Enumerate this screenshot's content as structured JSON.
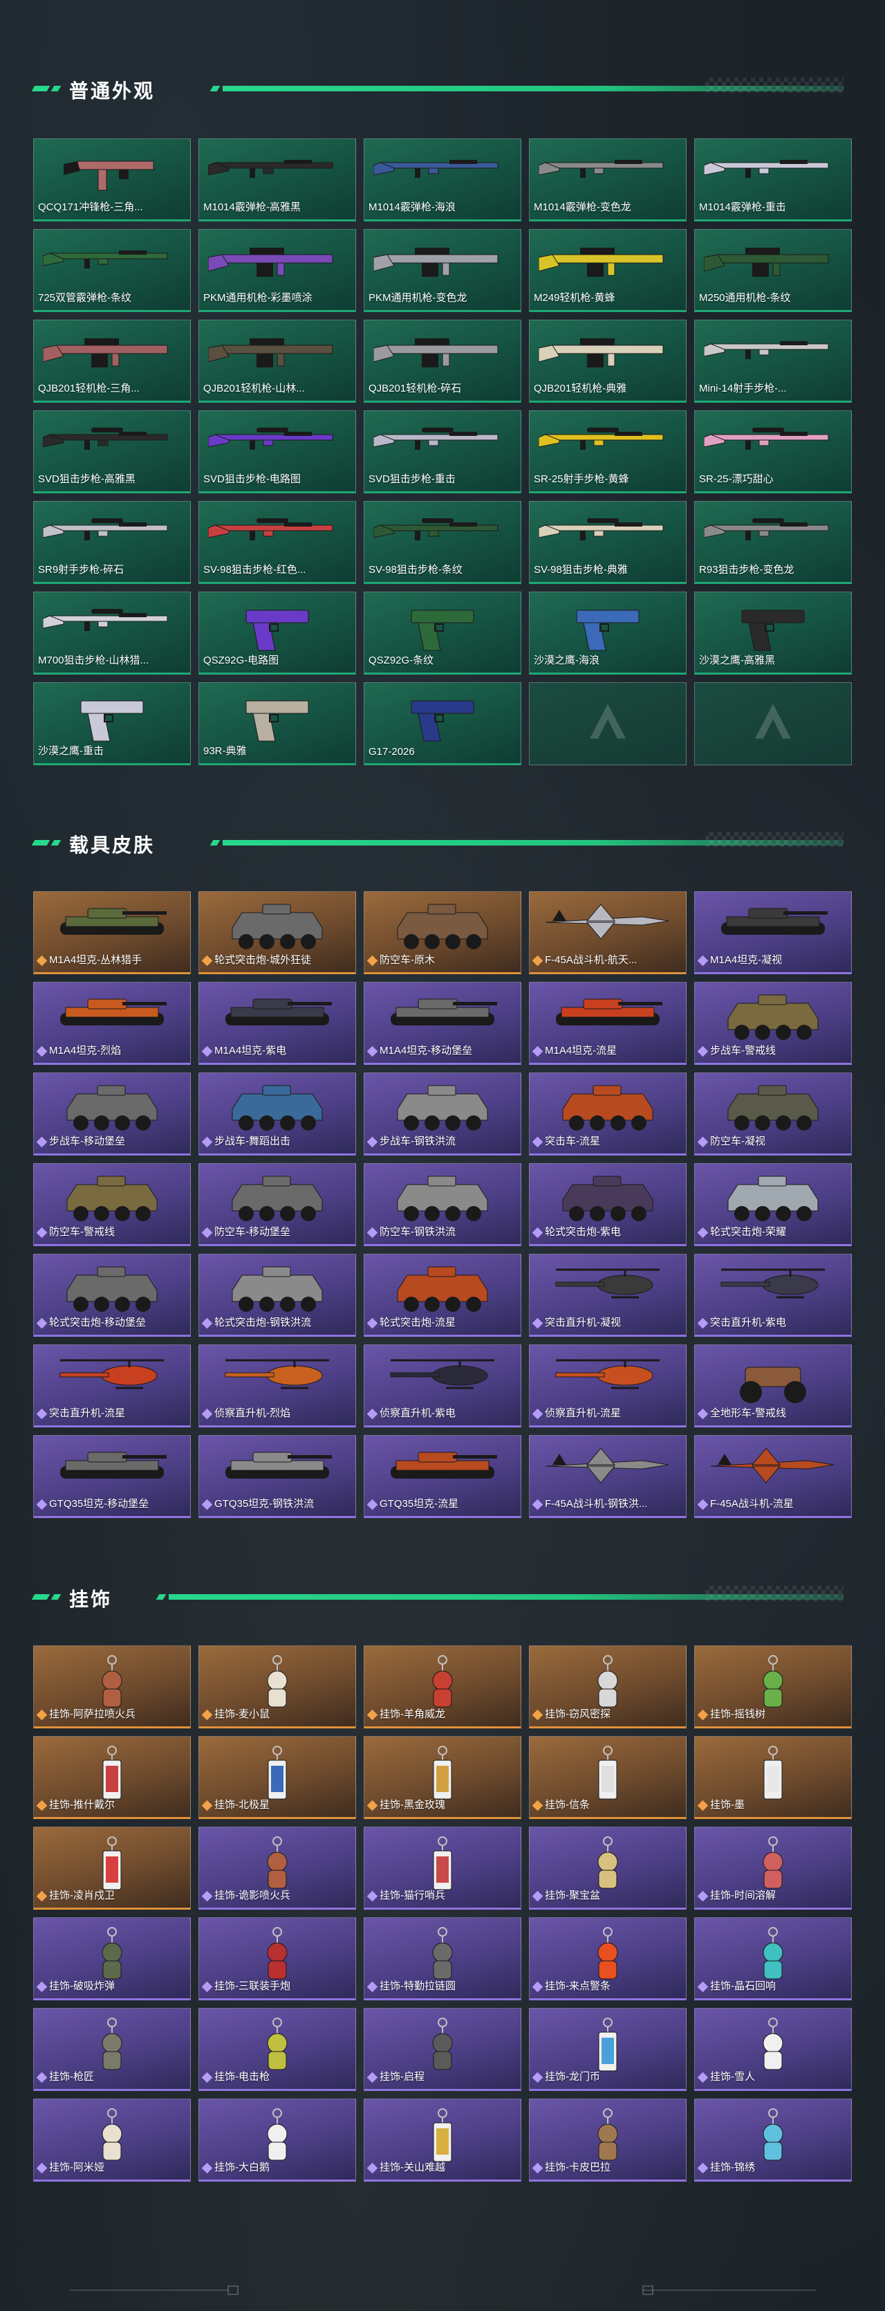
{
  "sections": [
    {
      "title": "普通外观",
      "rarity": "green",
      "items": [
        {
          "label": "QCQ171冲锋枪-三角...",
          "kind": "smg",
          "color": "#b06a6a"
        },
        {
          "label": "M1014霰弹枪-高雅黑",
          "kind": "shotgun",
          "color": "#2a2a2a"
        },
        {
          "label": "M1014霰弹枪-海浪",
          "kind": "shotgun",
          "color": "#3a5a9a"
        },
        {
          "label": "M1014霰弹枪-变色龙",
          "kind": "shotgun",
          "color": "#8a8a8a"
        },
        {
          "label": "M1014霰弹枪-重击",
          "kind": "shotgun",
          "color": "#c8c8d8"
        },
        {
          "label": "725双管霰弹枪-条纹",
          "kind": "rifle",
          "color": "#2f6a3a"
        },
        {
          "label": "PKM通用机枪-彩墨喷涂",
          "kind": "mg",
          "color": "#7a4ab8"
        },
        {
          "label": "PKM通用机枪-变色龙",
          "kind": "mg",
          "color": "#a0a0a8"
        },
        {
          "label": "M249轻机枪-黄蜂",
          "kind": "mg",
          "color": "#d8c428"
        },
        {
          "label": "M250通用机枪-条纹",
          "kind": "mg",
          "color": "#2d5a34"
        },
        {
          "label": "QJB201轻机枪-三角...",
          "kind": "mg",
          "color": "#a26060"
        },
        {
          "label": "QJB201轻机枪-山林...",
          "kind": "mg",
          "color": "#5a5040"
        },
        {
          "label": "QJB201轻机枪-碎石",
          "kind": "mg",
          "color": "#9a9aa0"
        },
        {
          "label": "QJB201轻机枪-典雅",
          "kind": "mg",
          "color": "#d8d0b8"
        },
        {
          "label": "Mini-14射手步枪-...",
          "kind": "rifle",
          "color": "#c8c8c8"
        },
        {
          "label": "SVD狙击步枪-高雅黑",
          "kind": "sniper",
          "color": "#2a2a2a"
        },
        {
          "label": "SVD狙击步枪-电路图",
          "kind": "sniper",
          "color": "#6a3ac8"
        },
        {
          "label": "SVD狙击步枪-重击",
          "kind": "sniper",
          "color": "#b8b8c8"
        },
        {
          "label": "SR-25射手步枪-黄蜂",
          "kind": "sniper",
          "color": "#e0c020"
        },
        {
          "label": "SR-25-漂巧甜心",
          "kind": "sniper",
          "color": "#e0a0c0"
        },
        {
          "label": "SR9射手步枪-碎石",
          "kind": "sniper",
          "color": "#c0c0c8"
        },
        {
          "label": "SV-98狙击步枪-红色...",
          "kind": "sniper",
          "color": "#c84040"
        },
        {
          "label": "SV-98狙击步枪-条纹",
          "kind": "sniper",
          "color": "#2d5a34"
        },
        {
          "label": "SV-98狙击步枪-典雅",
          "kind": "sniper",
          "color": "#d8d0b8"
        },
        {
          "label": "R93狙击步枪-变色龙",
          "kind": "sniper",
          "color": "#8a8a8a"
        },
        {
          "label": "M700狙击步枪-山林猎...",
          "kind": "sniper",
          "color": "#d0d0d8"
        },
        {
          "label": "QSZ92G-电路图",
          "kind": "pistol",
          "color": "#6a3ac8"
        },
        {
          "label": "QSZ92G-条纹",
          "kind": "pistol",
          "color": "#2d6a3a"
        },
        {
          "label": "沙漠之鹰-海浪",
          "kind": "pistol",
          "color": "#3a6ab8"
        },
        {
          "label": "沙漠之鹰-高雅黑",
          "kind": "pistol",
          "color": "#2a2a2a"
        },
        {
          "label": "沙漠之鹰-重击",
          "kind": "pistol",
          "color": "#c8c8d8"
        },
        {
          "label": "93R-典雅",
          "kind": "pistol",
          "color": "#b8b0a0"
        },
        {
          "label": "G17-2026",
          "kind": "pistol",
          "color": "#2a3a8a"
        },
        {
          "label": "",
          "kind": "empty",
          "color": ""
        },
        {
          "label": "",
          "kind": "empty",
          "color": ""
        }
      ]
    },
    {
      "title": "载具皮肤",
      "items": [
        {
          "label": "M1A4坦克-丛林猎手",
          "kind": "tank",
          "rarity": "orange",
          "color": "#5a6a3a"
        },
        {
          "label": "轮式突击炮-城外狂徒",
          "kind": "apc",
          "rarity": "orange",
          "color": "#6a6a6a"
        },
        {
          "label": "防空车-原木",
          "kind": "apc",
          "rarity": "orange",
          "color": "#7a5a40"
        },
        {
          "label": "F-45A战斗机-航天...",
          "kind": "jet",
          "rarity": "orange",
          "color": "#b8b8c0"
        },
        {
          "label": "M1A4坦克-凝视",
          "kind": "tank",
          "rarity": "purple",
          "color": "#3a3a3a"
        },
        {
          "label": "M1A4坦克-烈焰",
          "kind": "tank",
          "rarity": "purple",
          "color": "#c85a20"
        },
        {
          "label": "M1A4坦克-紫电",
          "kind": "tank",
          "rarity": "purple",
          "color": "#3a3a4a"
        },
        {
          "label": "M1A4坦克-移动堡垒",
          "kind": "tank",
          "rarity": "purple",
          "color": "#6a6a6a"
        },
        {
          "label": "M1A4坦克-流星",
          "kind": "tank",
          "rarity": "purple",
          "color": "#c84020"
        },
        {
          "label": "步战车-警戒线",
          "kind": "apc",
          "rarity": "purple",
          "color": "#7a6a40"
        },
        {
          "label": "步战车-移动堡垒",
          "kind": "apc",
          "rarity": "purple",
          "color": "#6a6a6a"
        },
        {
          "label": "步战车-舞蹈出击",
          "kind": "apc",
          "rarity": "purple",
          "color": "#3a6a9a"
        },
        {
          "label": "步战车-钢铁洪流",
          "kind": "apc",
          "rarity": "purple",
          "color": "#8a8a8a"
        },
        {
          "label": "突击车-流星",
          "kind": "apc",
          "rarity": "purple",
          "color": "#b84a20"
        },
        {
          "label": "防空车-凝视",
          "kind": "apc",
          "rarity": "purple",
          "color": "#5a5a4a"
        },
        {
          "label": "防空车-警戒线",
          "kind": "apc",
          "rarity": "purple",
          "color": "#7a6a40"
        },
        {
          "label": "防空车-移动堡垒",
          "kind": "apc",
          "rarity": "purple",
          "color": "#6a6a6a"
        },
        {
          "label": "防空车-钢铁洪流",
          "kind": "apc",
          "rarity": "purple",
          "color": "#8a8a8a"
        },
        {
          "label": "轮式突击炮-紫电",
          "kind": "apc",
          "rarity": "purple",
          "color": "#4a3a5a"
        },
        {
          "label": "轮式突击炮-荣耀",
          "kind": "apc",
          "rarity": "purple",
          "color": "#a0a8b0"
        },
        {
          "label": "轮式突击炮-移动堡垒",
          "kind": "apc",
          "rarity": "purple",
          "color": "#6a6a6a"
        },
        {
          "label": "轮式突击炮-钢铁洪流",
          "kind": "apc",
          "rarity": "purple",
          "color": "#8a8a8a"
        },
        {
          "label": "轮式突击炮-流星",
          "kind": "apc",
          "rarity": "purple",
          "color": "#b84a20"
        },
        {
          "label": "突击直升机-凝视",
          "kind": "heli",
          "rarity": "purple",
          "color": "#3a3a3a"
        },
        {
          "label": "突击直升机-紫电",
          "kind": "heli",
          "rarity": "purple",
          "color": "#3a3a4a"
        },
        {
          "label": "突击直升机-流星",
          "kind": "heli",
          "rarity": "purple",
          "color": "#c84020"
        },
        {
          "label": "侦察直升机-烈焰",
          "kind": "heli",
          "rarity": "purple",
          "color": "#c86020"
        },
        {
          "label": "侦察直升机-紫电",
          "kind": "heli",
          "rarity": "purple",
          "color": "#2a2a3a"
        },
        {
          "label": "侦察直升机-流星",
          "kind": "heli",
          "rarity": "purple",
          "color": "#c85020"
        },
        {
          "label": "全地形车-警戒线",
          "kind": "atv",
          "rarity": "purple",
          "color": "#8a5a3a"
        },
        {
          "label": "GTQ35坦克-移动堡垒",
          "kind": "tank",
          "rarity": "purple",
          "color": "#6a6a6a"
        },
        {
          "label": "GTQ35坦克-钢铁洪流",
          "kind": "tank",
          "rarity": "purple",
          "color": "#8a8a8a"
        },
        {
          "label": "GTQ35坦克-流星",
          "kind": "tank",
          "rarity": "purple",
          "color": "#b84a20"
        },
        {
          "label": "F-45A战斗机-钢铁洪...",
          "kind": "jet",
          "rarity": "purple",
          "color": "#8a8a8a"
        },
        {
          "label": "F-45A战斗机-流星",
          "kind": "jet",
          "rarity": "purple",
          "color": "#b84a20"
        }
      ]
    },
    {
      "title": "挂饰",
      "items": [
        {
          "label": "挂饰-阿萨拉喷火兵",
          "kind": "charm",
          "rarity": "orange",
          "color": "#b06040"
        },
        {
          "label": "挂饰-麦小鼠",
          "kind": "charm",
          "rarity": "orange",
          "color": "#e8e0d0"
        },
        {
          "label": "挂饰-羊角威龙",
          "kind": "charm",
          "rarity": "orange",
          "color": "#c84030"
        },
        {
          "label": "挂饰-窃风密探",
          "kind": "charm",
          "rarity": "orange",
          "color": "#d8d8d8"
        },
        {
          "label": "挂饰-摇钱树",
          "kind": "charm",
          "rarity": "orange",
          "color": "#6ab04a"
        },
        {
          "label": "挂饰-推什戴尔",
          "kind": "tag",
          "rarity": "orange",
          "color": "#c84040"
        },
        {
          "label": "挂饰-北极星",
          "kind": "tag",
          "rarity": "orange",
          "color": "#3a6ab8"
        },
        {
          "label": "挂饰-黑金玫瑰",
          "kind": "tag",
          "rarity": "orange",
          "color": "#d0a040"
        },
        {
          "label": "挂饰-信条",
          "kind": "tag",
          "rarity": "orange",
          "color": "#e0e0e0"
        },
        {
          "label": "挂饰-墨",
          "kind": "tag",
          "rarity": "orange",
          "color": "#e8e8e8"
        },
        {
          "label": "挂饰-凌肖戍卫",
          "kind": "tag",
          "rarity": "orange",
          "color": "#d84040"
        },
        {
          "label": "挂饰-诡影喷火兵",
          "kind": "charm",
          "rarity": "purple",
          "color": "#b06040"
        },
        {
          "label": "挂饰-猫行哨兵",
          "kind": "tag",
          "rarity": "purple",
          "color": "#c84a4a"
        },
        {
          "label": "挂饰-聚宝盆",
          "kind": "charm",
          "rarity": "purple",
          "color": "#d8c080"
        },
        {
          "label": "挂饰-时间溶解",
          "kind": "charm",
          "rarity": "purple",
          "color": "#d06060"
        },
        {
          "label": "挂饰-破吸炸弹",
          "kind": "charm",
          "rarity": "purple",
          "color": "#5a6a4a"
        },
        {
          "label": "挂饰-三联装手炮",
          "kind": "charm",
          "rarity": "purple",
          "color": "#b83030"
        },
        {
          "label": "挂饰-特勤拉链圆",
          "kind": "charm",
          "rarity": "purple",
          "color": "#6a6a6a"
        },
        {
          "label": "挂饰-来点警条",
          "kind": "charm",
          "rarity": "purple",
          "color": "#e85020"
        },
        {
          "label": "挂饰-晶石回响",
          "kind": "charm",
          "rarity": "purple",
          "color": "#40c0c0"
        },
        {
          "label": "挂饰-枪匠",
          "kind": "charm",
          "rarity": "purple",
          "color": "#7a7a6a"
        },
        {
          "label": "挂饰-电击枪",
          "kind": "charm",
          "rarity": "purple",
          "color": "#c0c040"
        },
        {
          "label": "挂饰-启程",
          "kind": "charm",
          "rarity": "purple",
          "color": "#5a5a5a"
        },
        {
          "label": "挂饰-龙门币",
          "kind": "tag",
          "rarity": "purple",
          "color": "#4aa0d8"
        },
        {
          "label": "挂饰-雪人",
          "kind": "charm",
          "rarity": "purple",
          "color": "#f0f0f0"
        },
        {
          "label": "挂饰-阿米娅",
          "kind": "charm",
          "rarity": "purple",
          "color": "#e8e0d0"
        },
        {
          "label": "挂饰-大白鹅",
          "kind": "charm",
          "rarity": "purple",
          "color": "#f0f0f0"
        },
        {
          "label": "挂饰-关山难越",
          "kind": "tag",
          "rarity": "purple",
          "color": "#d8b040"
        },
        {
          "label": "挂饰-卡皮巴拉",
          "kind": "charm",
          "rarity": "purple",
          "color": "#a07850"
        },
        {
          "label": "挂饰-锦绣",
          "kind": "charm",
          "rarity": "purple",
          "color": "#60c0e0"
        }
      ]
    }
  ],
  "colors": {
    "accent": "#27d88c",
    "green_card": "#155242",
    "orange_card": "#6f4b2d",
    "purple_card": "#4d3f86"
  }
}
